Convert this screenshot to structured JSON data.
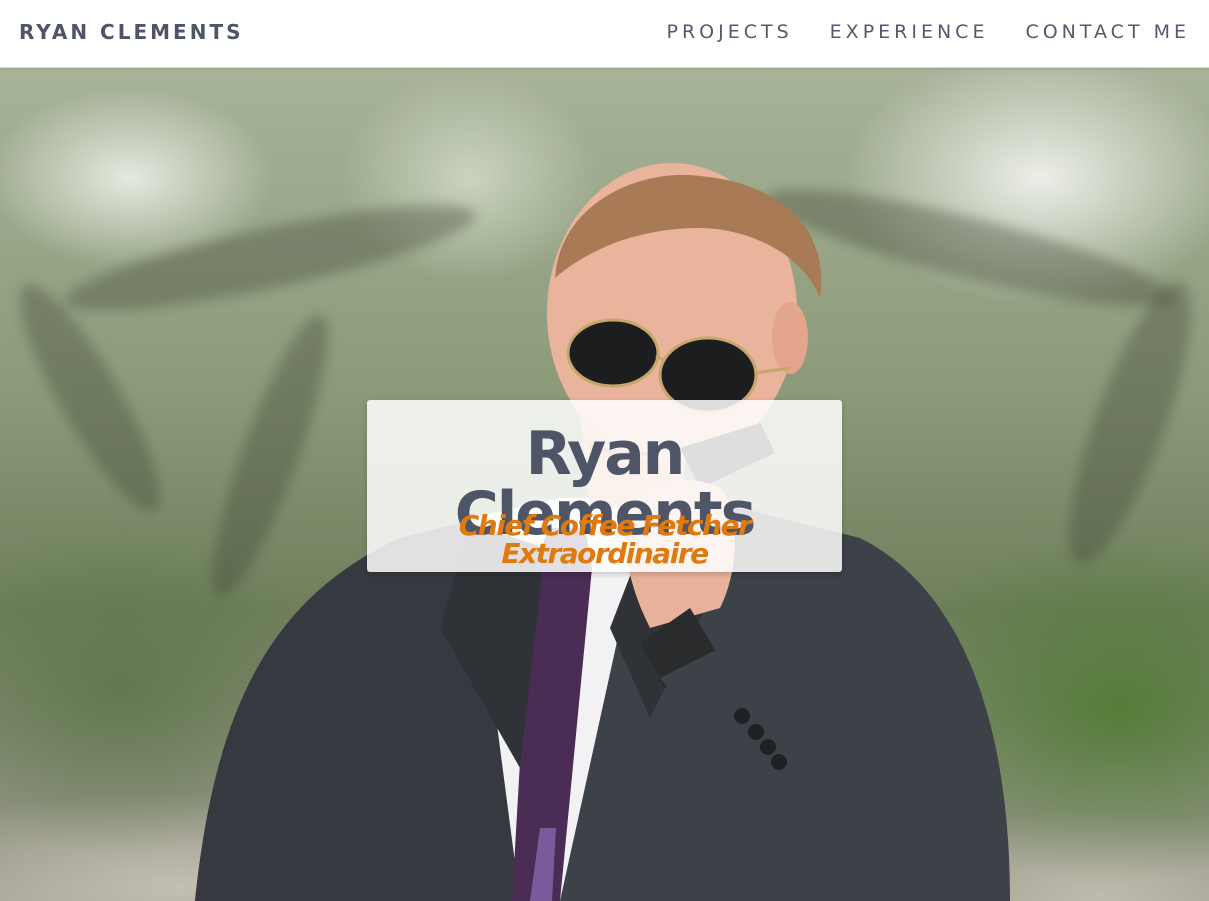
{
  "nav": {
    "brand": "RYAN CLEMENTS",
    "links": [
      "PROJECTS",
      "EXPERIENCE",
      "CONTACT ME"
    ]
  },
  "hero": {
    "name": "Ryan Clements",
    "tagline": "Chief Coffee Fetcher Extraordinaire",
    "photo": "hero-photo"
  },
  "colors": {
    "text_dark": "#4d5566",
    "accent": "#e07a10",
    "nav_bg": "#ffffff"
  }
}
